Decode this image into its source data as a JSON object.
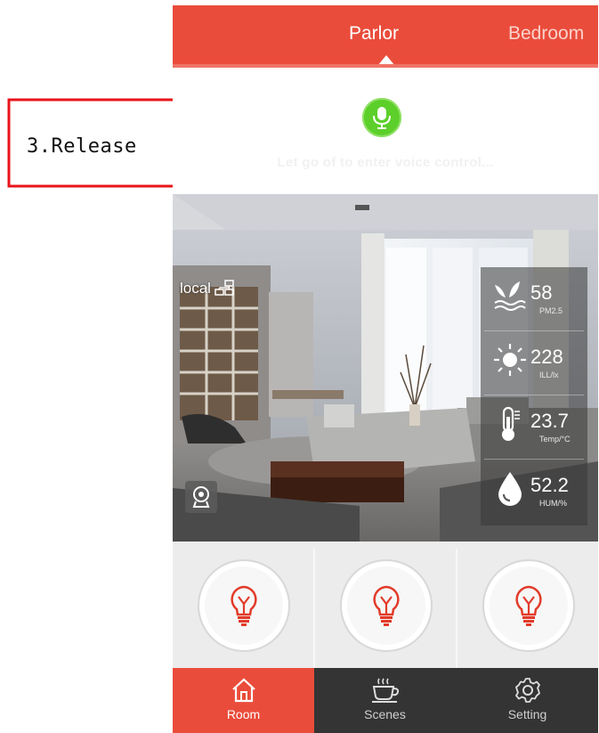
{
  "annotation": {
    "step_label": "3.Release",
    "color": "#e8141b"
  },
  "header": {
    "active_tab": "Parlor",
    "next_tab": "Bedroom",
    "bar_color": "#ea4c3b"
  },
  "voice": {
    "icon": "microphone-icon",
    "hint": "Let go of to enter voice control...",
    "mic_color": "#5ccf2a"
  },
  "room": {
    "connection_label": "local",
    "connection_icon": "network-icon",
    "camera_icon": "camera-icon",
    "sensors": [
      {
        "icon": "pm25-plant-icon",
        "value": "58",
        "unit": "PM2.5"
      },
      {
        "icon": "sun-icon",
        "value": "228",
        "unit": "ILL/lx"
      },
      {
        "icon": "thermometer-icon",
        "value": "23.7",
        "unit": "Temp/°C"
      },
      {
        "icon": "water-drop-icon",
        "value": "52.2",
        "unit": "HUM/%"
      }
    ]
  },
  "lights": [
    {
      "icon": "light-bulb-icon"
    },
    {
      "icon": "light-bulb-icon"
    },
    {
      "icon": "light-bulb-icon"
    }
  ],
  "bottom_nav": {
    "items": [
      {
        "label": "Room",
        "icon": "home-icon",
        "active": true
      },
      {
        "label": "Scenes",
        "icon": "coffee-cup-icon",
        "active": false
      },
      {
        "label": "Setting",
        "icon": "gear-icon",
        "active": false
      }
    ],
    "active_color": "#ea4c3b",
    "background": "#343434"
  }
}
